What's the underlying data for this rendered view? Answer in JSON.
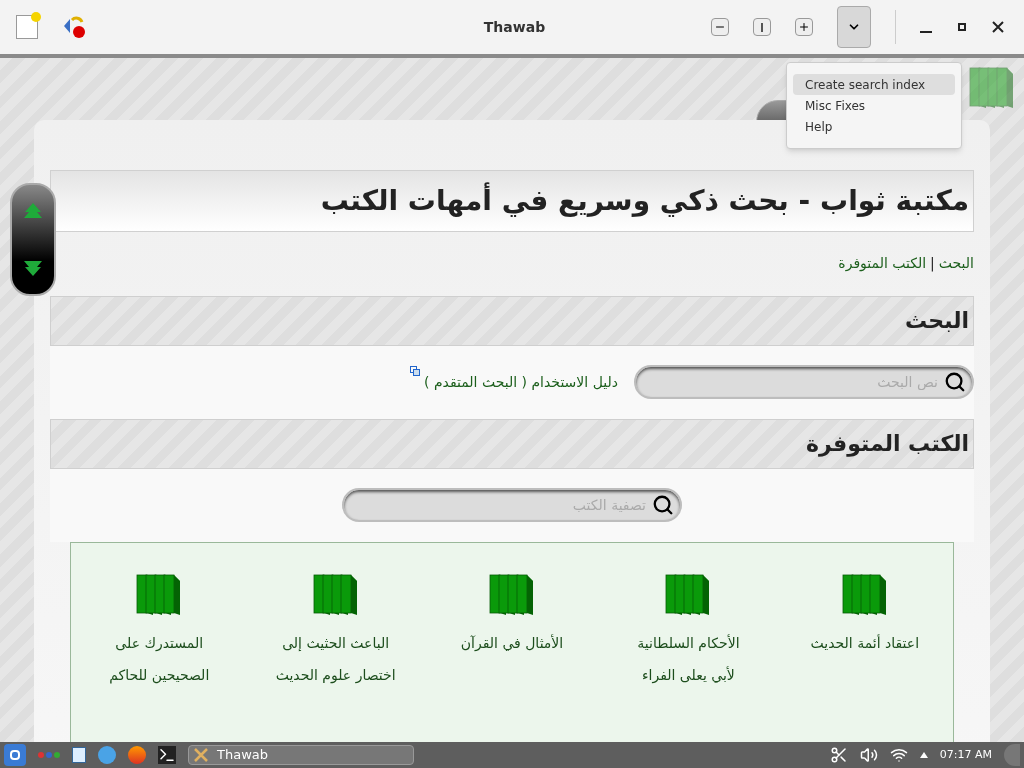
{
  "window": {
    "title": "Thawab"
  },
  "menu": {
    "open": true,
    "items": [
      {
        "label": "Create search index",
        "selected": true
      },
      {
        "label": "Misc Fixes",
        "selected": false
      },
      {
        "label": "Help",
        "selected": false
      }
    ]
  },
  "page": {
    "title": "مكتبة ثواب - بحث ذكي وسريع في أمهات الكتب",
    "nav": [
      "البحث",
      "الكتب المتوفرة"
    ],
    "nav_separator": "|",
    "search_section": {
      "heading": "البحث",
      "placeholder": "نص البحث",
      "help_link": "دليل الاستخدام ( البحث المتقدم )"
    },
    "books_section": {
      "heading": "الكتب المتوفرة",
      "placeholder": "تصفية الكتب",
      "books": [
        {
          "lines": [
            "اعتقاد أئمة الحديث"
          ]
        },
        {
          "lines": [
            "الأحكام السلطانية",
            "لأبي يعلى الفراء"
          ]
        },
        {
          "lines": [
            "الأمثال في القرآن"
          ]
        },
        {
          "lines": [
            "الباعث الحثيث إلى",
            "اختصار علوم الحديث"
          ]
        },
        {
          "lines": [
            "المستدرك على",
            "الصحيحين للحاكم"
          ]
        }
      ]
    }
  },
  "taskbar": {
    "task": "Thawab",
    "clock": "07:17 AM"
  }
}
